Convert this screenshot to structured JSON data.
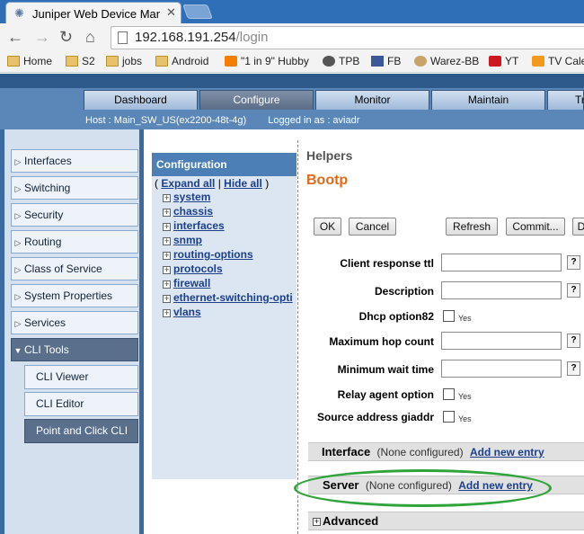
{
  "browser": {
    "tab_title": "Juniper Web Device Mana",
    "url_host": "192.168.191.254",
    "url_path": "/login",
    "bookmarks": [
      "Home",
      "S2",
      "jobs",
      "Android",
      "\"1 in 9\" Hubby",
      "TPB",
      "FB",
      "Warez-BB",
      "YT",
      "TV Cale"
    ]
  },
  "app": {
    "tabs": [
      "Dashboard",
      "Configure",
      "Monitor",
      "Maintain",
      "Tr"
    ],
    "host_line": "Host : Main_SW_US(ex2200-48t-4g)",
    "logged_in": "Logged in as : aviadr"
  },
  "sidebar": {
    "items": [
      "Interfaces",
      "Switching",
      "Security",
      "Routing",
      "Class of Service",
      "System Properties",
      "Services",
      "CLI Tools"
    ],
    "sub_items": [
      "CLI Viewer",
      "CLI Editor",
      "Point and Click CLI"
    ]
  },
  "tree": {
    "header": "Configuration",
    "expand_all": "Expand all",
    "hide_all": "Hide all",
    "nodes": [
      "system",
      "chassis",
      "interfaces",
      "snmp",
      "routing-options",
      "protocols",
      "firewall",
      "ethernet-switching-opti",
      "vlans"
    ]
  },
  "content": {
    "helpers": "Helpers",
    "title": "Bootp",
    "buttons": {
      "ok": "OK",
      "cancel": "Cancel",
      "refresh": "Refresh",
      "commit": "Commit...",
      "discard": "D"
    },
    "fields": {
      "client_response_ttl": "Client response ttl",
      "description": "Description",
      "dhcp_option82": "Dhcp option82",
      "maximum_hop_count": "Maximum hop count",
      "minimum_wait_time": "Minimum wait time",
      "relay_agent_option": "Relay agent option",
      "source_address_giaddr": "Source address giaddr"
    },
    "help_mark": "?",
    "yes_label": "Yes",
    "sections": {
      "interface": {
        "label": "Interface",
        "status": "(None configured)",
        "link": "Add new entry"
      },
      "server": {
        "label": "Server",
        "status": "(None configured)",
        "link": "Add new entry"
      },
      "advanced": {
        "label": "Advanced"
      }
    }
  },
  "colors": {
    "accent": "#e06a1a",
    "highlight_ring": "#2fa43a",
    "nav_active": "#5a6f8c"
  }
}
